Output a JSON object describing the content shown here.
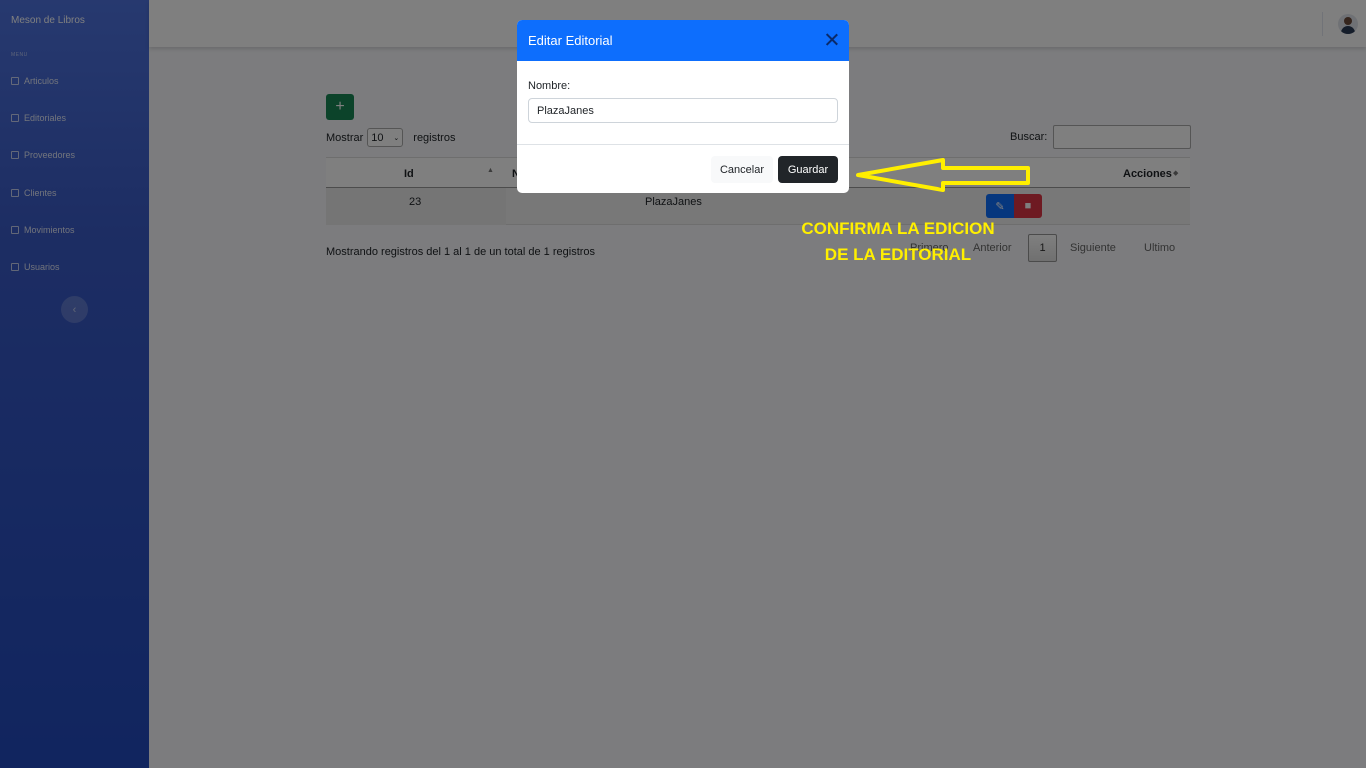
{
  "sidebar": {
    "brand": "Meson de Libros",
    "section_label": "MENU",
    "items": [
      {
        "label": "Articulos",
        "icon": "table-icon"
      },
      {
        "label": "Editoriales",
        "icon": "table-icon"
      },
      {
        "label": "Proveedores",
        "icon": "table-icon"
      },
      {
        "label": "Clientes",
        "icon": "table-icon"
      },
      {
        "label": "Movimientos",
        "icon": "table-icon"
      },
      {
        "label": "Usuarios",
        "icon": "table-icon"
      }
    ],
    "toggle_glyph": "‹"
  },
  "toolbar": {
    "add_glyph": "+",
    "show_label": "Mostrar",
    "show_value": "10",
    "records_label": "registros",
    "search_label": "Buscar:"
  },
  "table": {
    "headers": {
      "id": "Id",
      "name": "N",
      "actions": "Acciones"
    },
    "rows": [
      {
        "id": "23",
        "name": "PlazaJanes"
      }
    ]
  },
  "footer": {
    "info": "Mostrando registros del 1 al 1 de un total de 1 registros",
    "first": "Primero",
    "prev": "Anterior",
    "page": "1",
    "next": "Siguiente",
    "last": "Ultimo"
  },
  "modal": {
    "title": "Editar Editorial",
    "field_label": "Nombre:",
    "field_value": "PlazaJanes",
    "cancel_label": "Cancelar",
    "save_label": "Guardar"
  },
  "annotation": {
    "line1": "CONFIRMA LA EDICION",
    "line2": "DE LA EDITORIAL"
  },
  "colors": {
    "sidebar": "#4e73df",
    "modal_header": "#0d6efd",
    "save_button": "#212529",
    "annotation": "#ffef00"
  }
}
